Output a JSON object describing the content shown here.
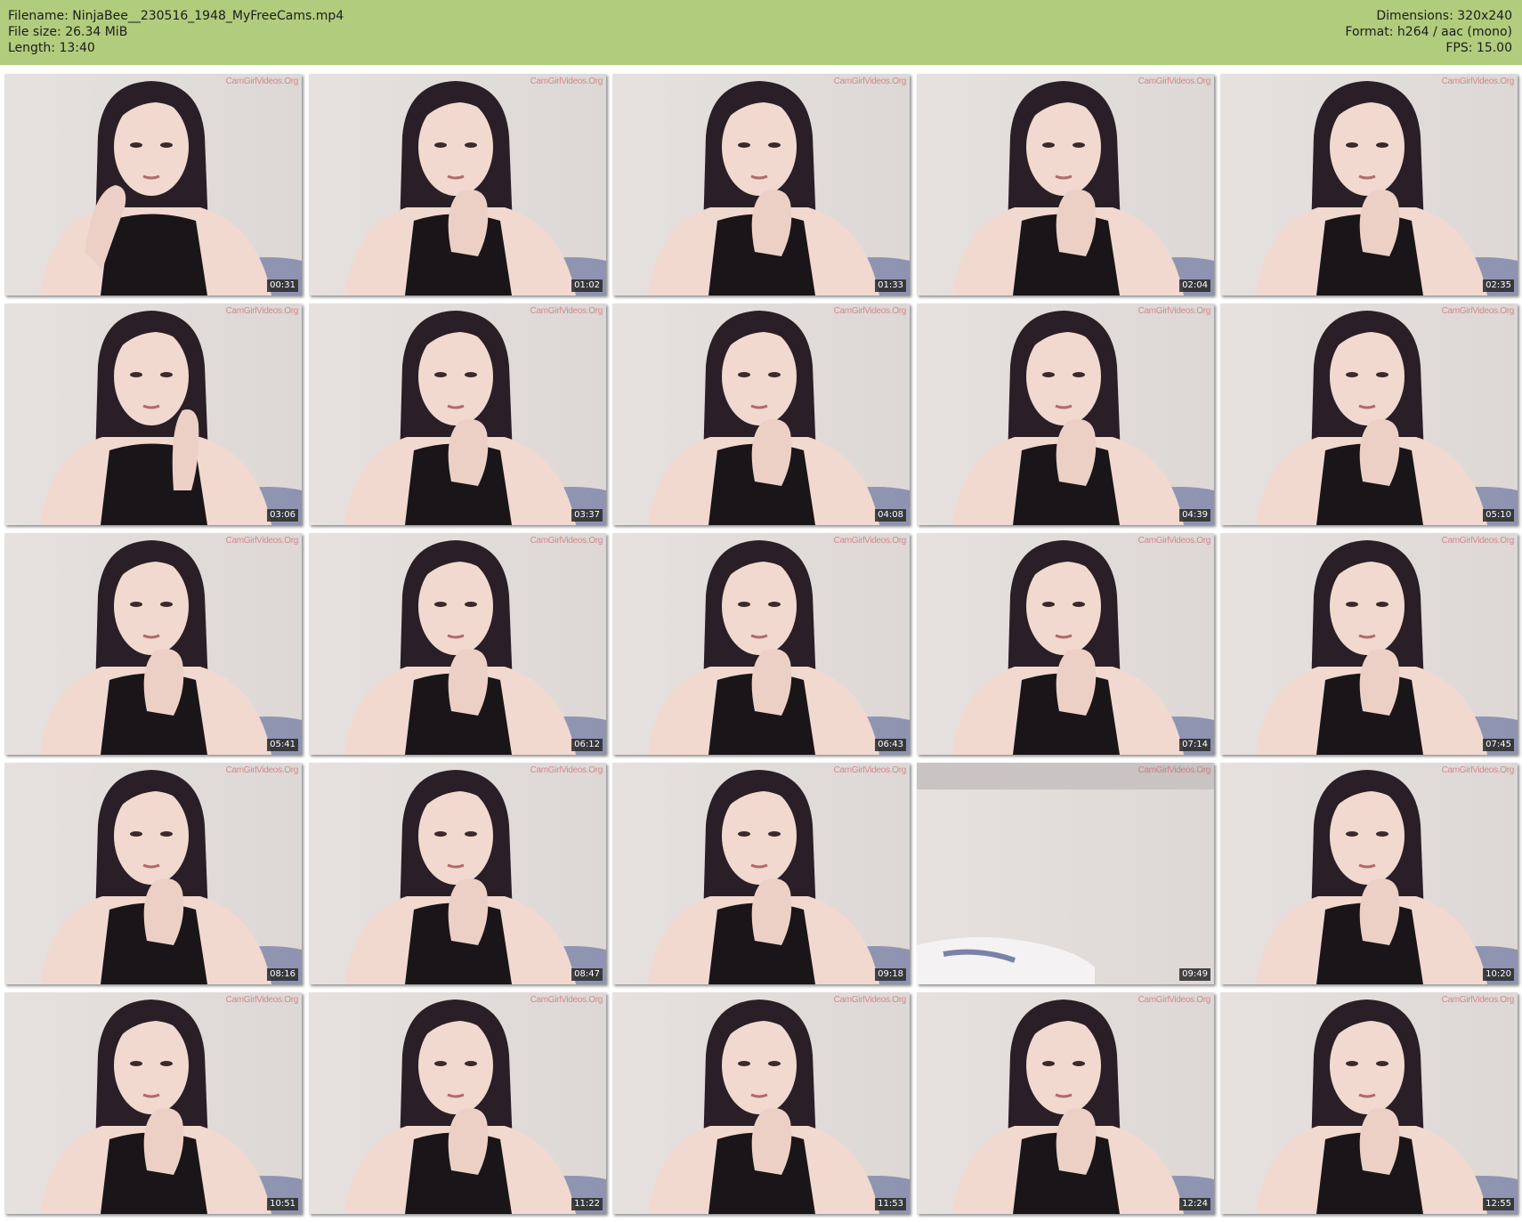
{
  "header": {
    "left": [
      "Filename: NinjaBee__230516_1948_MyFreeCams.mp4",
      "File size: 26.34 MiB",
      "Length: 13:40"
    ],
    "right": [
      "Dimensions: 320x240",
      "Format: h264 / aac (mono)",
      "FPS: 15.00"
    ],
    "background": "#b1cc7d"
  },
  "watermark": "CamGirlVideos.Org",
  "thumbnails": [
    {
      "time": "00:31",
      "scene": "person-waving"
    },
    {
      "time": "01:02",
      "scene": "person-chin-on-hand"
    },
    {
      "time": "01:33",
      "scene": "person-chin-on-hand"
    },
    {
      "time": "02:04",
      "scene": "person-chin-on-hand"
    },
    {
      "time": "02:35",
      "scene": "person-chin-on-hand"
    },
    {
      "time": "03:06",
      "scene": "person-hand-on-cheek"
    },
    {
      "time": "03:37",
      "scene": "person-chin-on-hand"
    },
    {
      "time": "04:08",
      "scene": "person-chin-on-hand"
    },
    {
      "time": "04:39",
      "scene": "person-chin-on-hand"
    },
    {
      "time": "05:10",
      "scene": "person-chin-on-hand"
    },
    {
      "time": "05:41",
      "scene": "person-chin-on-hand"
    },
    {
      "time": "06:12",
      "scene": "person-chin-on-hand"
    },
    {
      "time": "06:43",
      "scene": "person-chin-on-hand"
    },
    {
      "time": "07:14",
      "scene": "person-chin-on-hand"
    },
    {
      "time": "07:45",
      "scene": "person-chin-on-hand"
    },
    {
      "time": "08:16",
      "scene": "person-chin-on-hand"
    },
    {
      "time": "08:47",
      "scene": "person-chin-on-hand"
    },
    {
      "time": "09:18",
      "scene": "person-chin-on-hand"
    },
    {
      "time": "09:49",
      "scene": "empty-room"
    },
    {
      "time": "10:20",
      "scene": "person-leaning"
    },
    {
      "time": "10:51",
      "scene": "person-chin-on-hand"
    },
    {
      "time": "11:22",
      "scene": "person-chin-on-hand"
    },
    {
      "time": "11:53",
      "scene": "person-chin-on-hand"
    },
    {
      "time": "12:24",
      "scene": "person-chin-on-hand"
    },
    {
      "time": "12:55",
      "scene": "person-chin-on-hand"
    }
  ],
  "colors": {
    "wall": "#ddd8d6",
    "hair": "#2a1f26",
    "skin": "#f1d9d0",
    "top": "#1a1518",
    "bedding": "#7a82a8"
  }
}
